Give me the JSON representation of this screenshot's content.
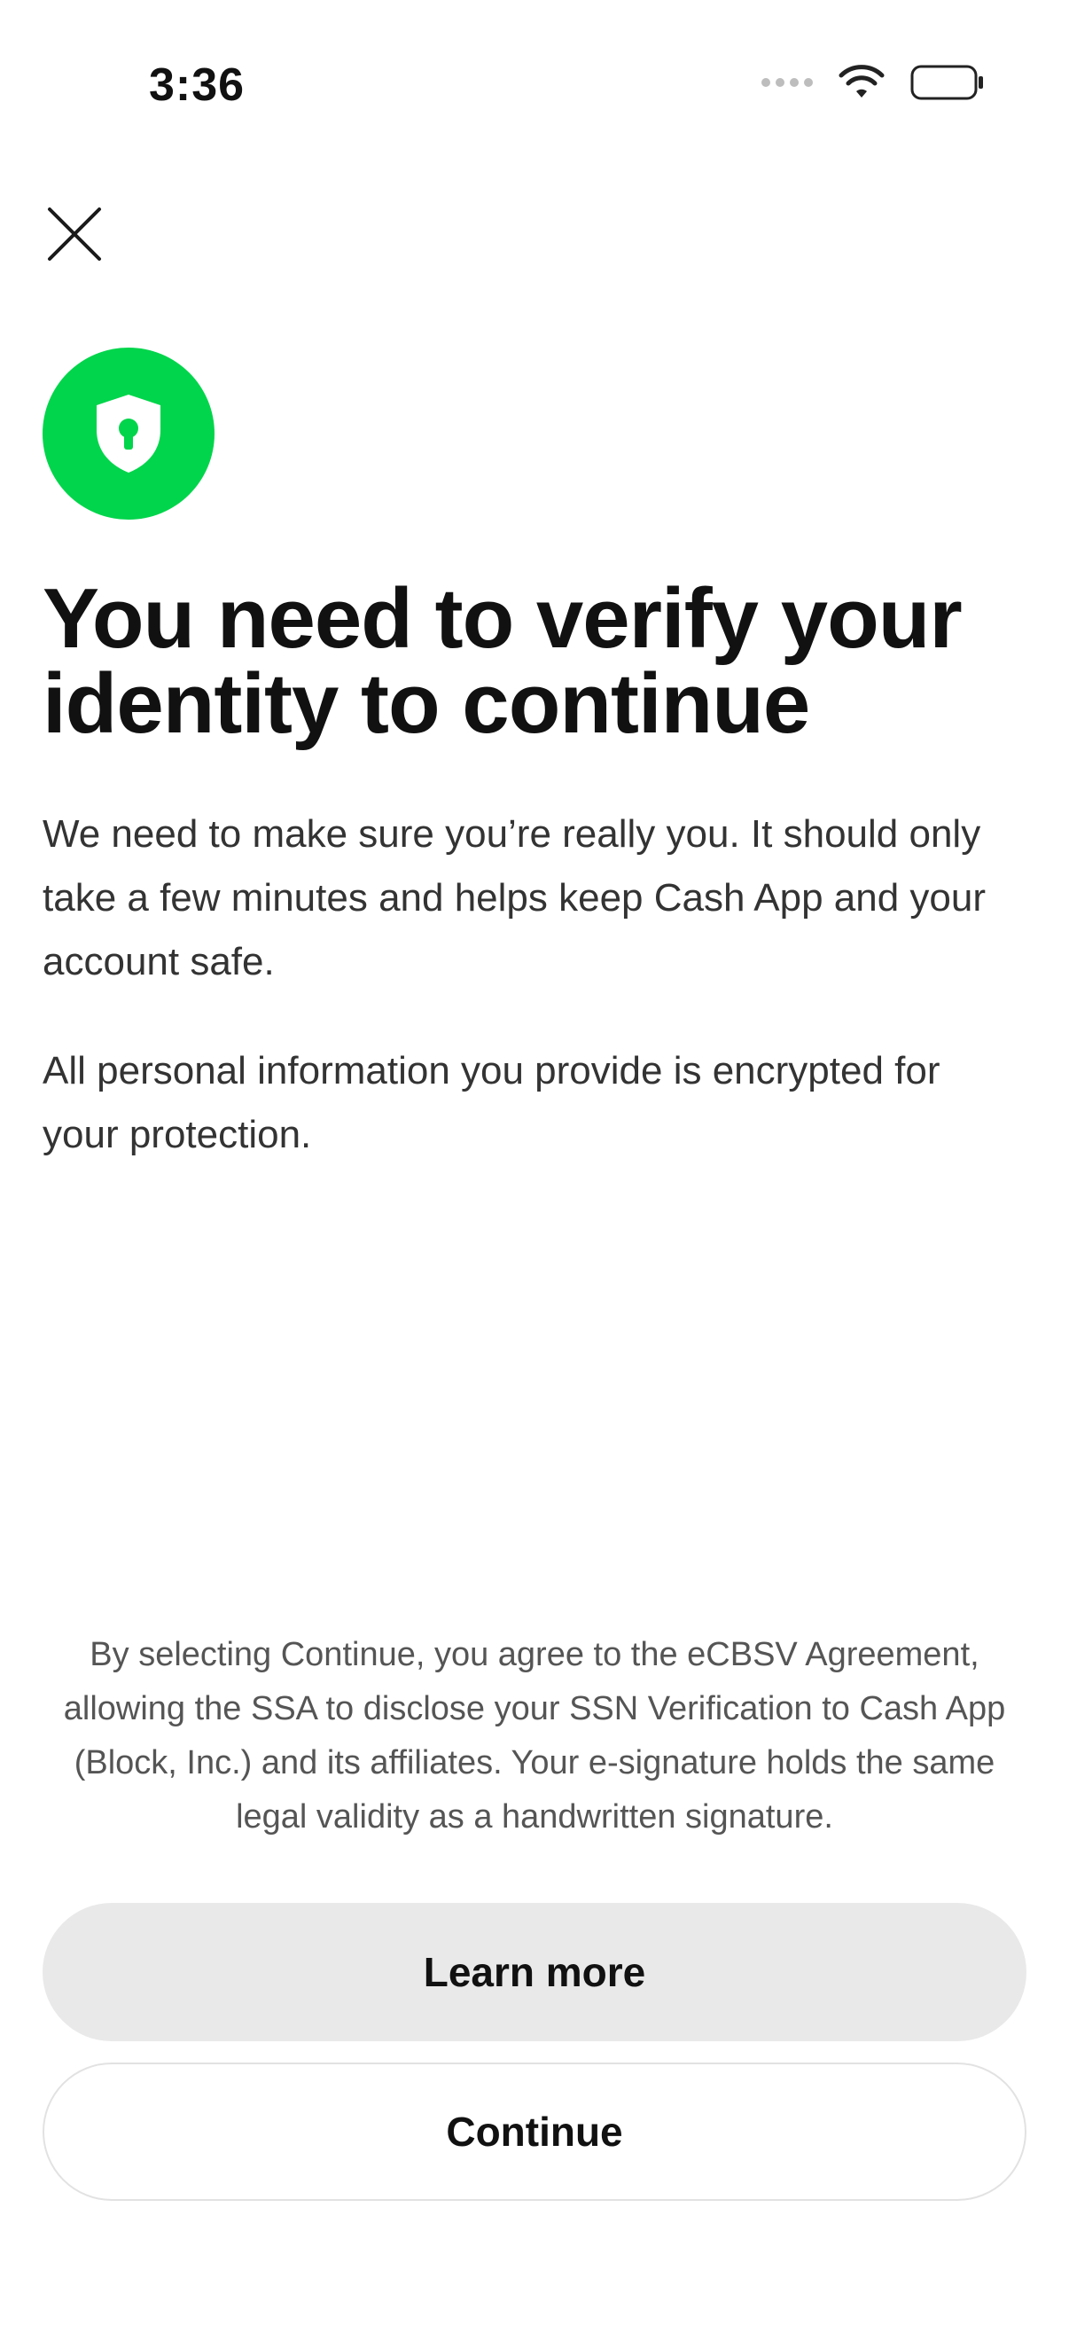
{
  "status_bar": {
    "time": "3:36",
    "wifi_icon": "wifi-icon",
    "battery_icon": "battery-icon",
    "signal_icon": "cellular-signal-icon"
  },
  "header": {
    "close_icon": "close-icon"
  },
  "badge": {
    "icon": "shield-lock-icon",
    "color": "#00d54b"
  },
  "content": {
    "title": "You need to verify your identity to continue",
    "paragraph_1": "We need to make sure you’re really you. It should only take a few minutes and helps keep Cash App and your account safe.",
    "paragraph_2": "All personal information you provide is encrypted for your protection."
  },
  "footer": {
    "legal": "By selecting Continue, you agree to the eCBSV Agreement, allowing the SSA to disclose your SSN Verification to Cash App (Block, Inc.) and its affiliates. Your e-signature holds the same legal validity as a handwritten signature.",
    "learn_more_label": "Learn more",
    "continue_label": "Continue"
  }
}
